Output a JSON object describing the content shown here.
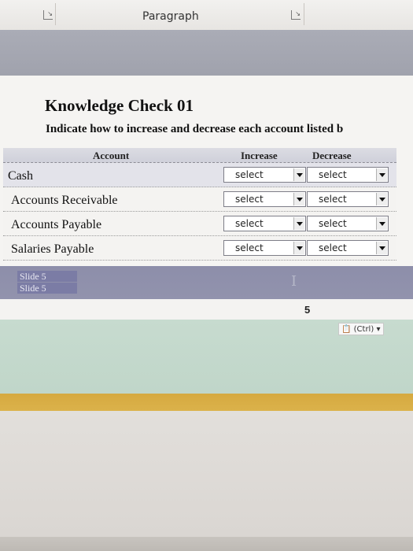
{
  "ribbon": {
    "group_label": "Paragraph"
  },
  "slide": {
    "title": "Knowledge Check 01",
    "instructions": "Indicate how to increase and decrease each account listed b",
    "columns": [
      "Account",
      "Increase",
      "Decrease"
    ],
    "rows": [
      {
        "account": "Cash",
        "increase": "select",
        "decrease": "select"
      },
      {
        "account": "Accounts Receivable",
        "increase": "select",
        "decrease": "select"
      },
      {
        "account": "Accounts Payable",
        "increase": "select",
        "decrease": "select"
      },
      {
        "account": "Salaries Payable",
        "increase": "select",
        "decrease": "select"
      }
    ],
    "slide_tags": [
      "Slide 5",
      "Slide 5"
    ]
  },
  "status": {
    "page_number": "5",
    "paste_options": "(Ctrl)"
  },
  "icons": {
    "dialog_launcher": "dialog-launcher-icon",
    "dropdown_arrow": "chevron-down-icon",
    "paste": "clipboard-icon",
    "text_cursor": "ibeam-cursor-icon"
  },
  "colors": {
    "header_band": "#a3a5b0",
    "slide_band": "#8f90ab",
    "green_band": "#c3d8cb",
    "orange_band": "#d8ad45"
  }
}
